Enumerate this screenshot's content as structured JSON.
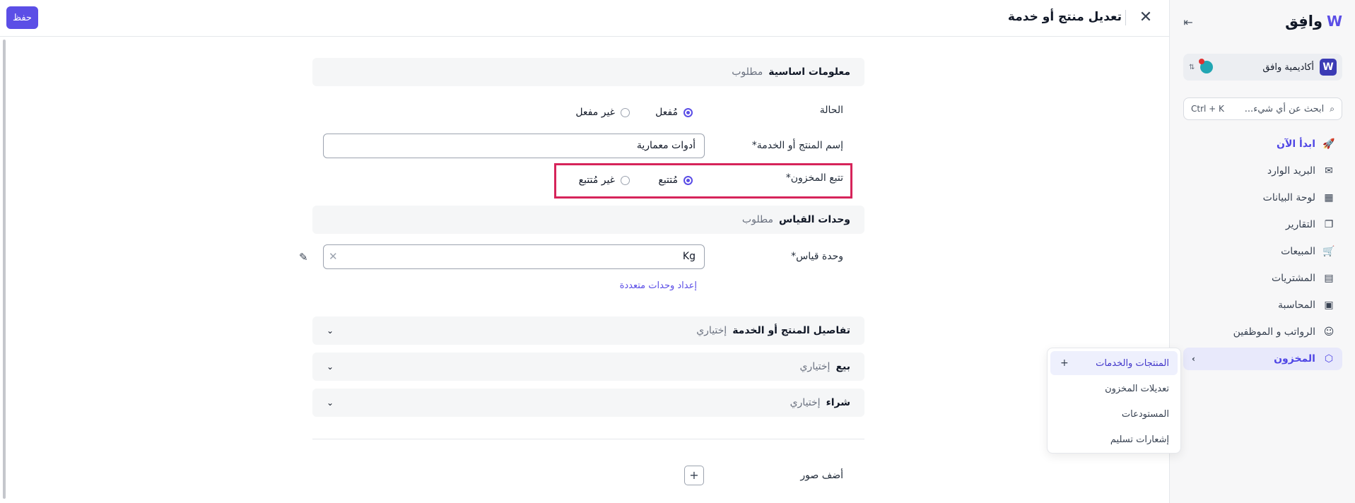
{
  "header": {
    "title": "تعديل منتج أو خدمة",
    "save_label": "حفظ"
  },
  "sidebar": {
    "logo_text": "وافِق",
    "org_name": "أكاديمية وافق",
    "org_badge": "W",
    "search_placeholder": "ابحث عن أي شيء...",
    "search_shortcut": "Ctrl + K",
    "items": [
      {
        "label": "ابدأ الآن",
        "icon": "rocket-icon"
      },
      {
        "label": "البريد الوارد",
        "icon": "inbox-icon"
      },
      {
        "label": "لوحة البيانات",
        "icon": "dashboard-icon"
      },
      {
        "label": "التقارير",
        "icon": "reports-icon"
      },
      {
        "label": "المبيعات",
        "icon": "cart-icon"
      },
      {
        "label": "المشتريات",
        "icon": "receipt-icon"
      },
      {
        "label": "المحاسبة",
        "icon": "ledger-icon"
      },
      {
        "label": "الرواتب و الموظفين",
        "icon": "people-icon"
      },
      {
        "label": "المخزون",
        "icon": "box-icon"
      }
    ]
  },
  "flyout": {
    "items": [
      {
        "label": "المنتجات والخدمات"
      },
      {
        "label": "تعديلات المخزون"
      },
      {
        "label": "المستودعات"
      },
      {
        "label": "إشعارات تسليم"
      }
    ]
  },
  "form": {
    "basic_section": {
      "title": "معلومات اساسية",
      "tag": "مطلوب"
    },
    "status": {
      "label": "الحالة",
      "options": [
        "مُفعل",
        "غير مفعل"
      ],
      "selected": "مُفعل"
    },
    "name": {
      "label": "إسم المنتج أو الخدمة*",
      "value": "أدوات معمارية"
    },
    "tracking": {
      "label": "تتبع المخزون*",
      "options": [
        "مُتتبع",
        "غير مُتتبع"
      ],
      "selected": "مُتتبع"
    },
    "units_section": {
      "title": "وحدات القياس",
      "tag": "مطلوب"
    },
    "unit": {
      "label": "وحدة قياس*",
      "value": "Kg"
    },
    "multi_units_link": "إعداد وحدات متعددة",
    "details_section": {
      "title": "تفاصيل المنتج أو الخدمة",
      "tag": "إختياري"
    },
    "sell_section": {
      "title": "بيع",
      "tag": "إختياري"
    },
    "buy_section": {
      "title": "شراء",
      "tag": "إختياري"
    },
    "photos_label": "أضف صور"
  },
  "colors": {
    "accent": "#5b4ee6",
    "highlight": "#d6245a"
  }
}
